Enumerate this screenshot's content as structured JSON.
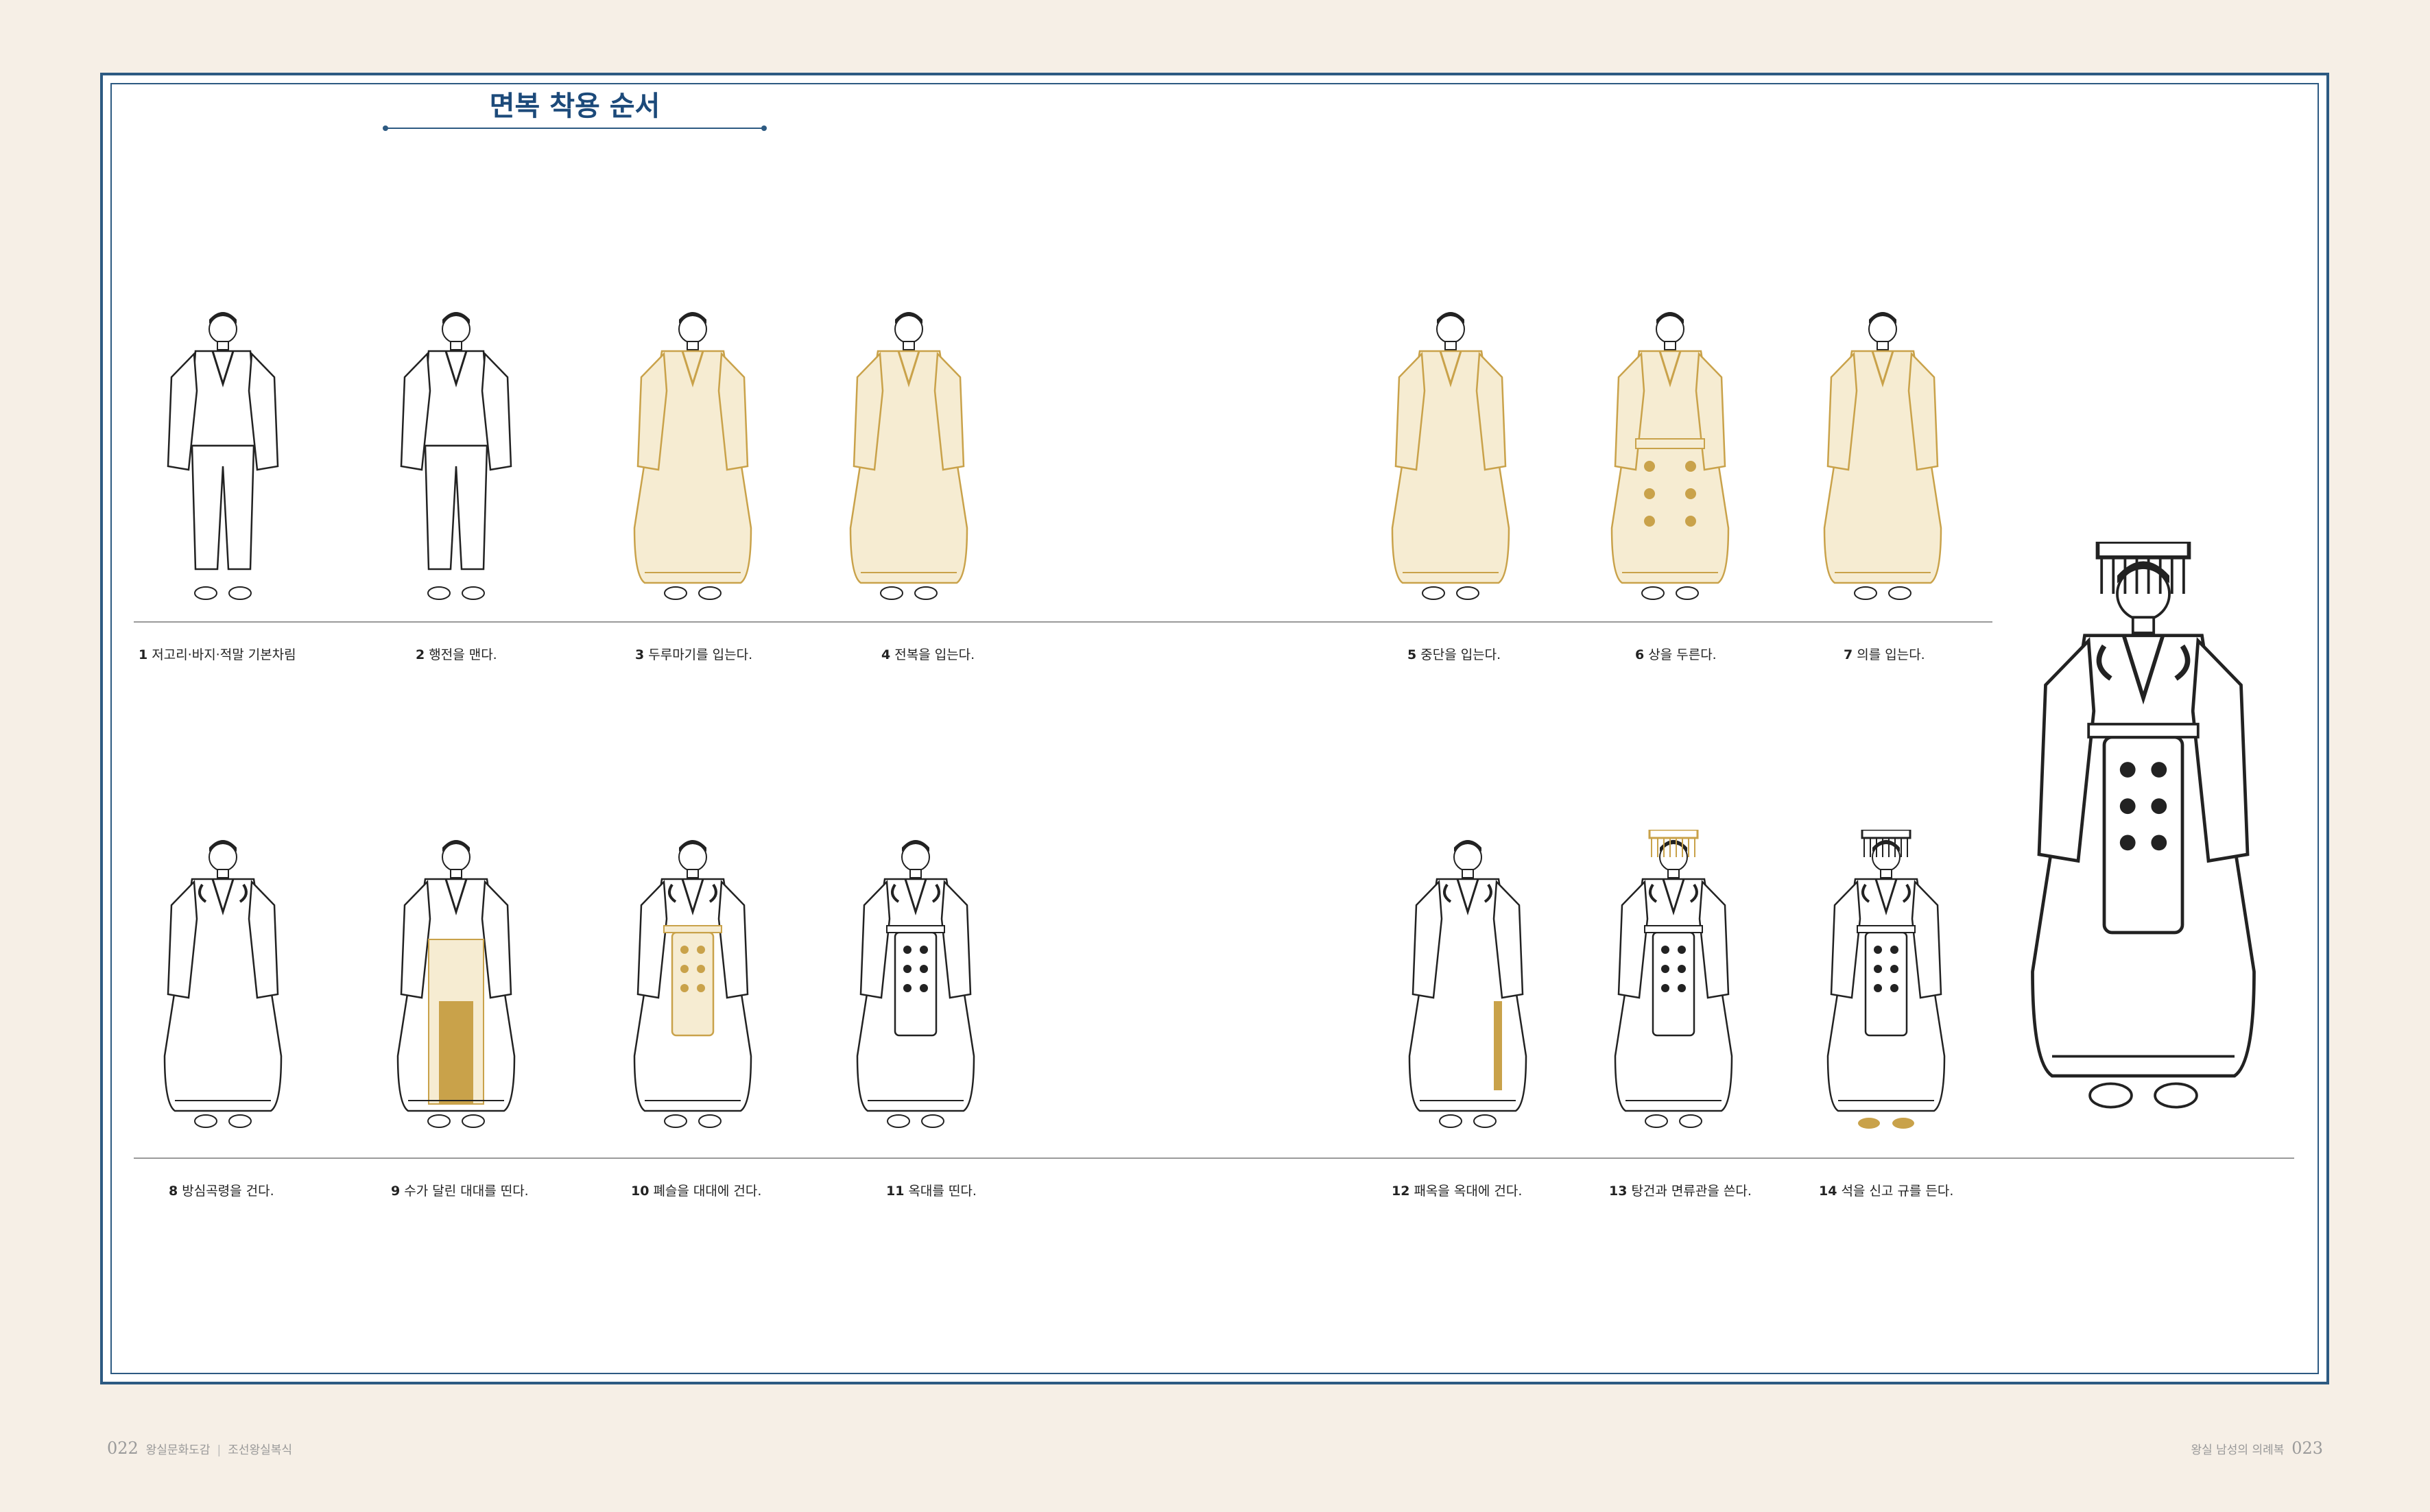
{
  "title": "면복 착용 순서",
  "colors": {
    "frame": "#2d5a82",
    "gold": "#c9a24a",
    "gold_fill": "#f6ecd2",
    "line": "#222222",
    "page": "#f6efe6"
  },
  "steps": [
    {
      "num": "1",
      "text": "저고리·바지·적말 기본차림"
    },
    {
      "num": "2",
      "text": "행전을 맨다."
    },
    {
      "num": "3",
      "text": "두루마기를 입는다."
    },
    {
      "num": "4",
      "text": "전복을 입는다."
    },
    {
      "num": "5",
      "text": "중단을 입는다."
    },
    {
      "num": "6",
      "text": "상을 두른다."
    },
    {
      "num": "7",
      "text": "의를 입는다."
    },
    {
      "num": "8",
      "text": "방심곡령을 건다."
    },
    {
      "num": "9",
      "text": "수가 달린 대대를 띤다."
    },
    {
      "num": "10",
      "text": "폐슬을 대대에 건다."
    },
    {
      "num": "11",
      "text": "옥대를 띤다."
    },
    {
      "num": "12",
      "text": "패옥을 옥대에 건다."
    },
    {
      "num": "13",
      "text": "탕건과 면류관을 쓴다."
    },
    {
      "num": "14",
      "text": "석을 신고 규를 든다."
    }
  ],
  "footer": {
    "left_num": "022",
    "left_book": "왕실문화도감",
    "left_section": "조선왕실복식",
    "right_text": "왕실 남성의 의례복",
    "right_num": "023"
  }
}
